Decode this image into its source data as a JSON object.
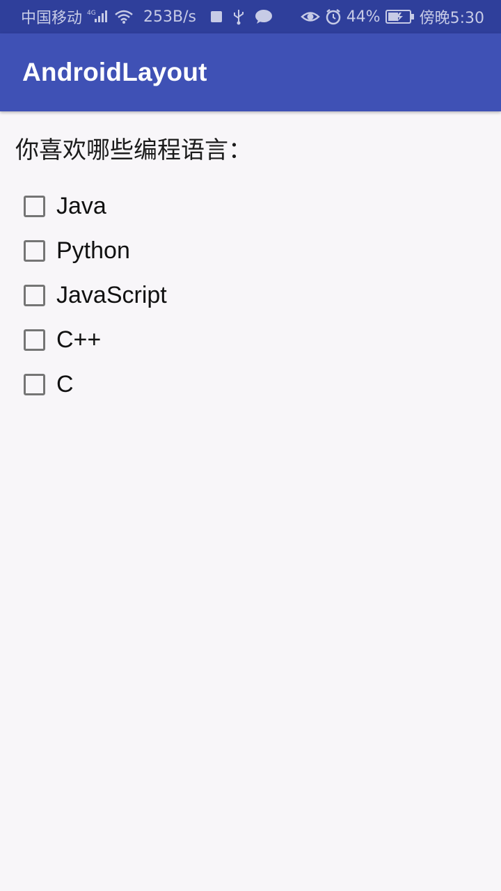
{
  "colors": {
    "status_bar": "#2f3f9b",
    "app_bar": "#3f51b5",
    "background": "#f8f6f9",
    "checkbox_border": "#757575"
  },
  "status_bar": {
    "carrier": "中国移动",
    "network_type": "4G",
    "net_speed": "253B/s",
    "battery_percent": "44%",
    "time": "傍晚5:30",
    "icons": [
      "signal-icon",
      "wifi-icon",
      "notification-square-icon",
      "usb-icon",
      "message-icon",
      "eye-icon",
      "alarm-icon",
      "battery-icon"
    ]
  },
  "app_bar": {
    "title": "AndroidLayout"
  },
  "main": {
    "question": "你喜欢哪些编程语言：",
    "options": [
      {
        "label": "Java",
        "checked": false
      },
      {
        "label": "Python",
        "checked": false
      },
      {
        "label": "JavaScript",
        "checked": false
      },
      {
        "label": "C++",
        "checked": false
      },
      {
        "label": "C",
        "checked": false
      }
    ]
  }
}
